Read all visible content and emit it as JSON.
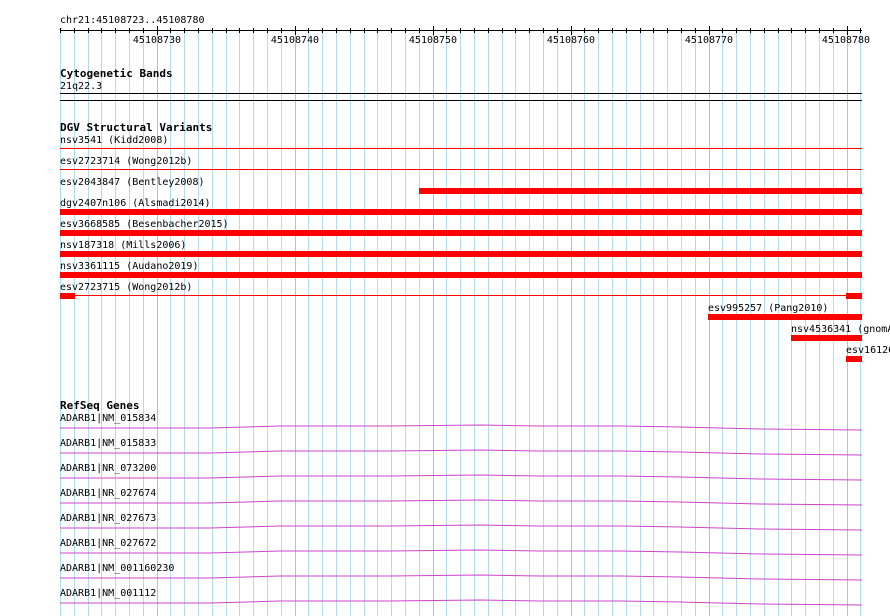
{
  "ruler": {
    "location": "chr21:45108723..45108780",
    "tick_labels": [
      "45108730",
      "45108740",
      "45108750",
      "45108760",
      "45108770",
      "45108780"
    ]
  },
  "cytogenetic": {
    "title": "Cytogenetic Bands",
    "band": "21q22.3"
  },
  "dgv": {
    "title": "DGV Structural Variants",
    "features": [
      {
        "label": "nsv3541 (Kidd2008)"
      },
      {
        "label": "esv2723714 (Wong2012b)"
      },
      {
        "label": "esv2043847 (Bentley2008)"
      },
      {
        "label": "dgv2407n106 (Alsmadi2014)"
      },
      {
        "label": "esv3668585 (Besenbacher2015)"
      },
      {
        "label": "nsv187318 (Mills2006)"
      },
      {
        "label": "nsv3361115 (Audano2019)"
      },
      {
        "label": "esv2723715 (Wong2012b)"
      },
      {
        "label": "esv995257 (Pang2010)"
      },
      {
        "label": "nsv4536341 (gnomA"
      },
      {
        "label": "esv16126"
      }
    ]
  },
  "refseq": {
    "title": "RefSeq Genes",
    "genes": [
      {
        "label": "ADARB1|NM_015834"
      },
      {
        "label": "ADARB1|NM_015833"
      },
      {
        "label": "ADARB1|NR_073200"
      },
      {
        "label": "ADARB1|NR_027674"
      },
      {
        "label": "ADARB1|NR_027673"
      },
      {
        "label": "ADARB1|NR_027672"
      },
      {
        "label": "ADARB1|NM_001160230"
      },
      {
        "label": "ADARB1|NM_001112"
      }
    ]
  },
  "colors": {
    "variant": "#ff0000",
    "gene": "#cc44cc",
    "grid": "#b5dceb"
  }
}
